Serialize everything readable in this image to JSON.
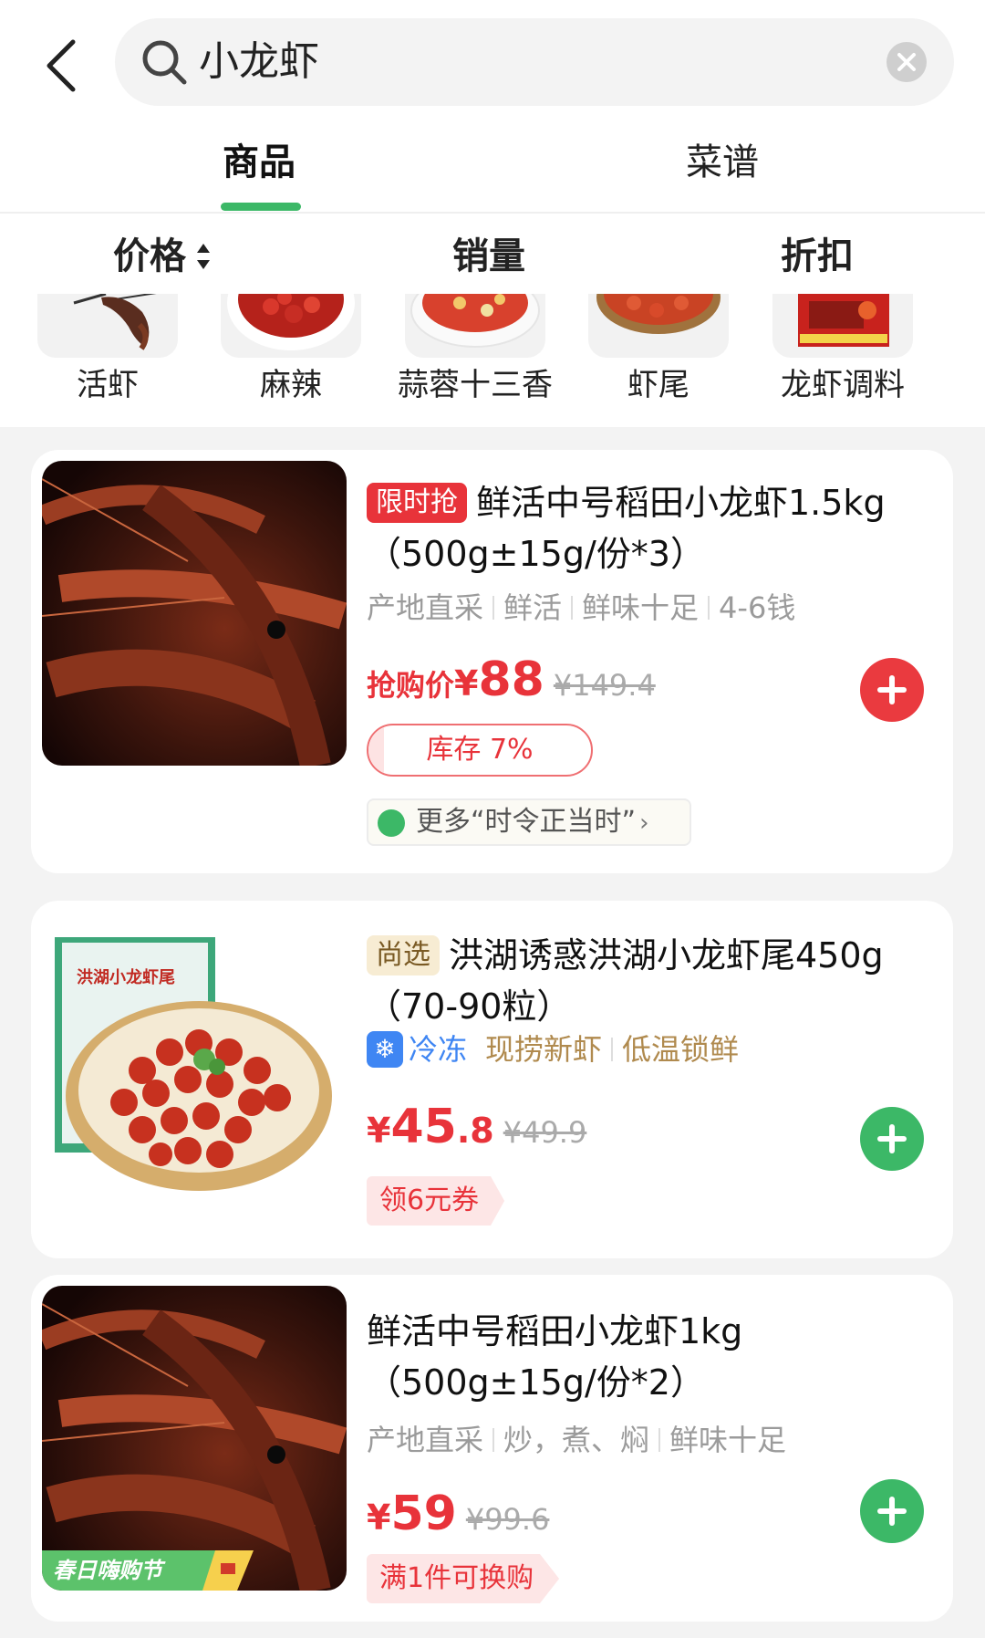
{
  "search": {
    "query": "小龙虾"
  },
  "tabs": [
    {
      "label": "商品",
      "active": true
    },
    {
      "label": "菜谱",
      "active": false
    }
  ],
  "sort": {
    "price": "价格",
    "sales": "销量",
    "discount": "折扣"
  },
  "categories": [
    {
      "label": "活虾"
    },
    {
      "label": "麻辣"
    },
    {
      "label": "蒜蓉十三香"
    },
    {
      "label": "虾尾"
    },
    {
      "label": "龙虾调料"
    }
  ],
  "products": [
    {
      "tag": "限时抢",
      "title": "鲜活中号稻田小龙虾1.5kg（500g±15g/份*3）",
      "attrs": [
        "产地直采",
        "鲜活",
        "鲜味十足",
        "4-6钱"
      ],
      "price_prefix": "抢购价",
      "currency": "¥",
      "price": "88",
      "price_decimal": "",
      "original_price": "¥149.4",
      "stock_label": "库存 7%",
      "stock_percent": 7,
      "more_label": "更多“时令正当时”",
      "add_color": "#ea3a3f"
    },
    {
      "tag": "尚选",
      "title": "洪湖诱惑洪湖小龙虾尾450g（70-90粒）",
      "frozen_label": "冷冻",
      "attrs": [
        "现捞新虾",
        "低温锁鲜"
      ],
      "currency": "¥",
      "price": "45",
      "price_decimal": ".8",
      "original_price": "¥49.9",
      "coupon": "领6元券",
      "package_text": "洪湖小龙虾尾",
      "add_color": "#3cb867"
    },
    {
      "title": "鲜活中号稻田小龙虾1kg（500g±15g/份*2）",
      "attrs": [
        "产地直采",
        "炒，煮、焖",
        "鲜味十足"
      ],
      "currency": "¥",
      "price": "59",
      "price_decimal": "",
      "original_price": "¥99.6",
      "coupon": "满1件可换购",
      "badge": "春日嗨购节",
      "add_color": "#3cb867"
    }
  ]
}
